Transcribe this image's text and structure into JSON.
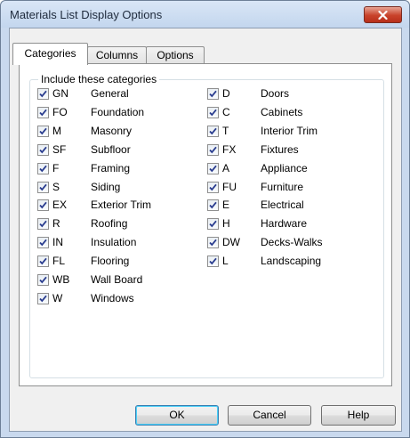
{
  "window": {
    "title": "Materials List Display Options",
    "close_icon": "close-x-icon"
  },
  "tabs": [
    {
      "label": "Categories",
      "active": true
    },
    {
      "label": "Columns",
      "active": false
    },
    {
      "label": "Options",
      "active": false
    }
  ],
  "group": {
    "label": "Include these categories"
  },
  "categories": [
    {
      "code": "GN",
      "name": "General",
      "checked": true
    },
    {
      "code": "FO",
      "name": "Foundation",
      "checked": true
    },
    {
      "code": "M",
      "name": "Masonry",
      "checked": true
    },
    {
      "code": "SF",
      "name": "Subfloor",
      "checked": true
    },
    {
      "code": "F",
      "name": "Framing",
      "checked": true
    },
    {
      "code": "S",
      "name": "Siding",
      "checked": true
    },
    {
      "code": "EX",
      "name": "Exterior Trim",
      "checked": true
    },
    {
      "code": "R",
      "name": "Roofing",
      "checked": true
    },
    {
      "code": "IN",
      "name": "Insulation",
      "checked": true
    },
    {
      "code": "FL",
      "name": "Flooring",
      "checked": true
    },
    {
      "code": "WB",
      "name": "Wall Board",
      "checked": true
    },
    {
      "code": "W",
      "name": "Windows",
      "checked": true
    },
    {
      "code": "D",
      "name": "Doors",
      "checked": true
    },
    {
      "code": "C",
      "name": "Cabinets",
      "checked": true
    },
    {
      "code": "T",
      "name": "Interior Trim",
      "checked": true
    },
    {
      "code": "FX",
      "name": "Fixtures",
      "checked": true
    },
    {
      "code": "A",
      "name": "Appliance",
      "checked": true
    },
    {
      "code": "FU",
      "name": "Furniture",
      "checked": true
    },
    {
      "code": "E",
      "name": "Electrical",
      "checked": true
    },
    {
      "code": "H",
      "name": "Hardware",
      "checked": true
    },
    {
      "code": "DW",
      "name": "Decks-Walks",
      "checked": true
    },
    {
      "code": "L",
      "name": "Landscaping",
      "checked": true
    }
  ],
  "buttons": {
    "ok": "OK",
    "cancel": "Cancel",
    "help": "Help"
  }
}
